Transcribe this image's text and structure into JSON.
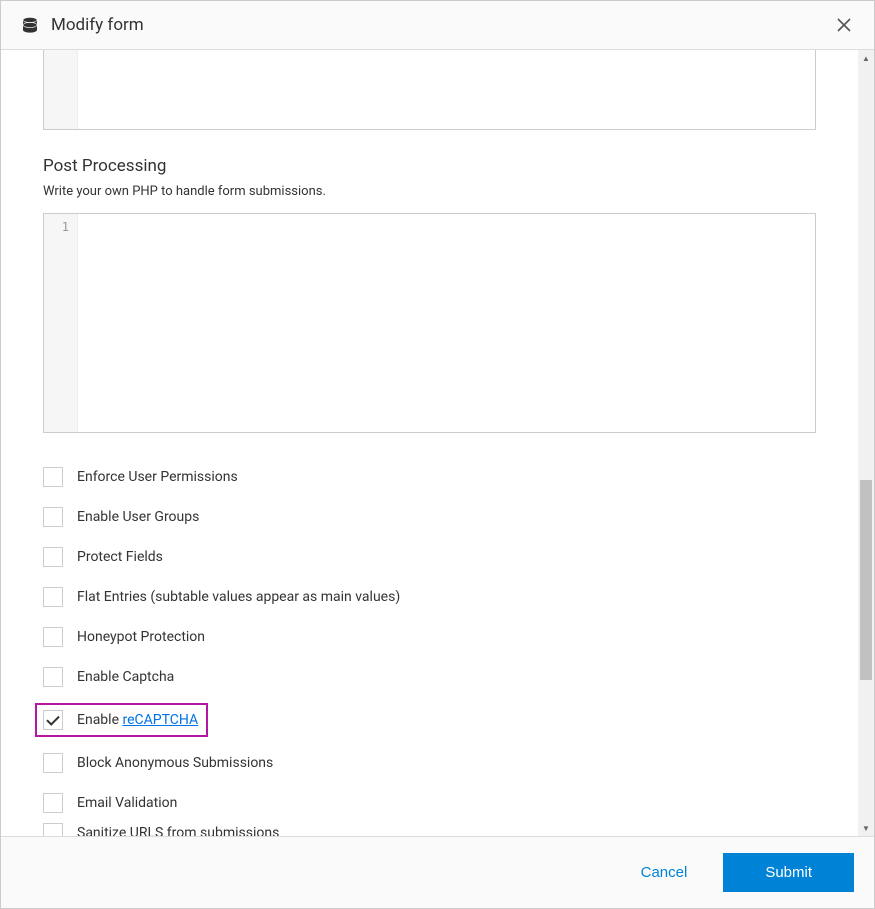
{
  "header": {
    "title": "Modify form"
  },
  "section": {
    "title": "Post Processing",
    "desc": "Write your own PHP to handle form submissions.",
    "line_number": "1"
  },
  "checkboxes": {
    "enforce_permissions": {
      "label": "Enforce User Permissions",
      "checked": false
    },
    "enable_user_groups": {
      "label": "Enable User Groups",
      "checked": false
    },
    "protect_fields": {
      "label": "Protect Fields",
      "checked": false
    },
    "flat_entries": {
      "label": "Flat Entries (subtable values appear as main values)",
      "checked": false
    },
    "honeypot": {
      "label": "Honeypot Protection",
      "checked": false
    },
    "enable_captcha": {
      "label": "Enable Captcha",
      "checked": false
    },
    "enable_recaptcha": {
      "label_prefix": "Enable ",
      "link_text": "reCAPTCHA",
      "checked": true
    },
    "block_anon": {
      "label": "Block Anonymous Submissions",
      "checked": false
    },
    "email_validation": {
      "label": "Email Validation",
      "checked": false
    },
    "sanitize_urls": {
      "label": "Sanitize URLS from submissions",
      "checked": false
    }
  },
  "footer": {
    "cancel": "Cancel",
    "submit": "Submit"
  }
}
